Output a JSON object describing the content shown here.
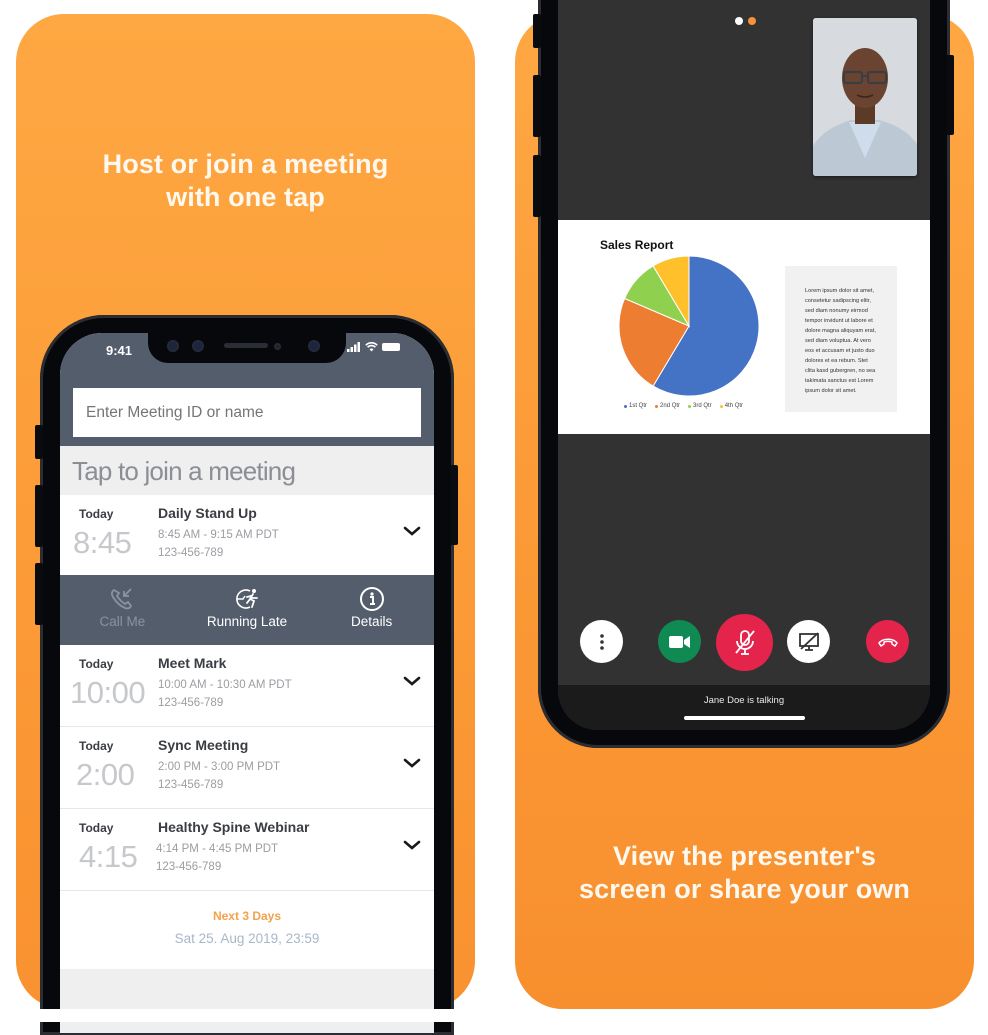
{
  "left_card": {
    "headline_line1": "Host or join a meeting",
    "headline_line2": "with one tap",
    "phone": {
      "status_time": "9:41",
      "search_placeholder": "Enter Meeting ID or name",
      "tap_label": "Tap to join a meeting",
      "meetings": [
        {
          "day": "Today",
          "big_time": "8:45",
          "title": "Daily Stand Up",
          "time_range": "8:45 AM - 9:15 AM PDT",
          "meeting_id": "123-456-789"
        },
        {
          "day": "Today",
          "big_time": "10:00",
          "title": "Meet Mark",
          "time_range": "10:00 AM - 10:30 AM PDT",
          "meeting_id": "123-456-789"
        },
        {
          "day": "Today",
          "big_time": "2:00",
          "title": "Sync Meeting",
          "time_range": "2:00 PM - 3:00 PM PDT",
          "meeting_id": "123-456-789"
        },
        {
          "day": "Today",
          "big_time": "4:15",
          "title": "Healthy Spine Webinar",
          "time_range": "4:14 PM - 4:45 PM PDT",
          "meeting_id": "123-456-789"
        }
      ],
      "actions": [
        {
          "label": "Call Me",
          "icon": "phone-incoming-icon",
          "enabled": false
        },
        {
          "label": "Running Late",
          "icon": "running-late-icon",
          "enabled": true
        },
        {
          "label": "Details",
          "icon": "info-icon",
          "enabled": true
        }
      ],
      "next_days_label": "Next 3 Days",
      "next_date": "Sat 25. Aug 2019, 23:59"
    }
  },
  "right_card": {
    "headline_line1": "View the presenter's",
    "headline_line2": "screen or share your own",
    "phone": {
      "page_dots": [
        {
          "active": false,
          "color": "#ffffff"
        },
        {
          "active": true,
          "color": "#f7923a"
        }
      ],
      "slide_title": "Sales Report",
      "slide_text": "Lorem ipsum dolor sit amet, consetetur sadipscing elitr, sed diam nonumy eirmod tempor invidunt ut labore et dolore magna aliquyam erat, sed diam voluptua. At vero eos et accusam et justo duo dolores et ea rebum. Stet clita kasd gubergren, no sea takimata sanctus est Lorem ipsum dolor sit amet.",
      "controls": [
        {
          "name": "more-options",
          "icon": "more-vertical-icon",
          "bg": "#ffffff"
        },
        {
          "name": "video",
          "icon": "video-camera-icon",
          "bg": "#0f8a53"
        },
        {
          "name": "mute",
          "icon": "mic-off-icon",
          "bg": "#e5244c"
        },
        {
          "name": "share-screen",
          "icon": "screen-share-off-icon",
          "bg": "#ffffff"
        },
        {
          "name": "hang-up",
          "icon": "hang-up-icon",
          "bg": "#e5244c"
        }
      ],
      "talking_status": "Jane Doe is talking"
    }
  },
  "colors": {
    "card_orange": "#fca241",
    "header_slate": "#545d6c",
    "accent_orange": "#f6a04a",
    "danger_red": "#e5244c",
    "video_green": "#0f8a53"
  },
  "chart_data": {
    "type": "pie",
    "title": "Sales Report",
    "categories": [
      "1st Qtr",
      "2nd Qtr",
      "3rd Qtr",
      "4th Qtr"
    ],
    "values": [
      8.2,
      3.2,
      1.4,
      1.2
    ],
    "colors": [
      "#4472c4",
      "#ed7d31",
      "#8fd14f",
      "#ffc02b"
    ],
    "legend": "bottom"
  }
}
